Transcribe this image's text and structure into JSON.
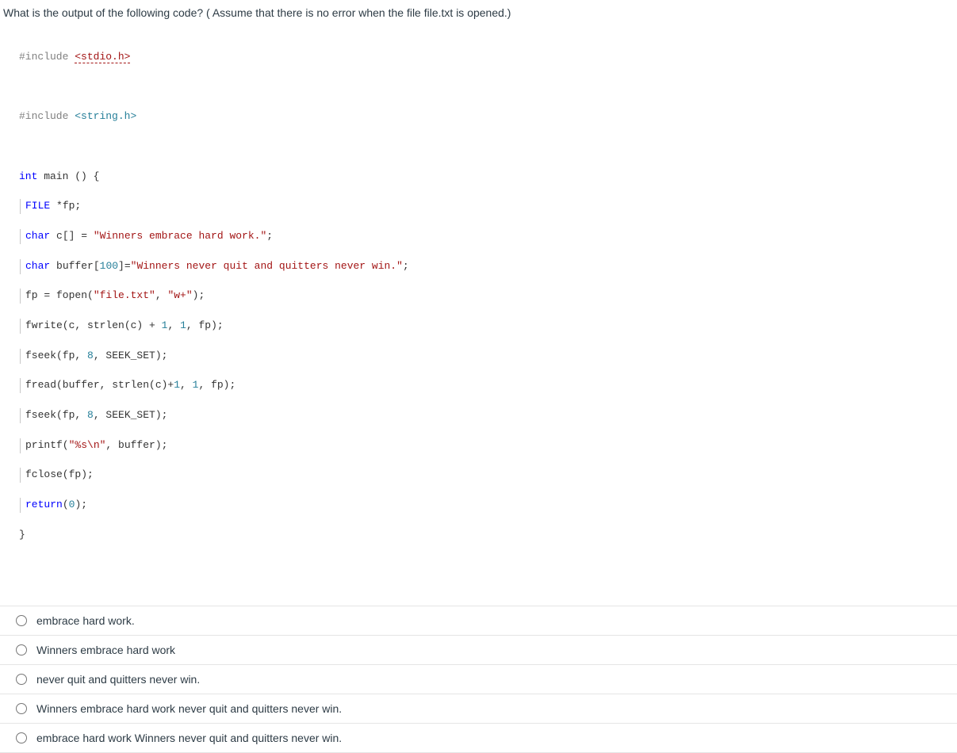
{
  "question": "What is the output of the following code? ( Assume that there is no error when the file file.txt is opened.)",
  "code": {
    "l1_inc": "#include",
    "l1_hdr": "<stdio.h>",
    "l2_inc": "#include",
    "l2_hdr": "<string.h>",
    "l3_type": "int",
    "l3_rest": " main () {",
    "l4a": "FILE",
    "l4b": " *fp;",
    "l5a": "char",
    "l5b": " c[] = ",
    "l5c": "\"Winners embrace hard work.\"",
    "l5d": ";",
    "l6a": "char",
    "l6b": " buffer[",
    "l6c": "100",
    "l6d": "]=",
    "l6e": "\"Winners never quit and quitters never win.\"",
    "l6f": ";",
    "l7a": "fp = fopen(",
    "l7b": "\"file.txt\"",
    "l7c": ", ",
    "l7d": "\"w+\"",
    "l7e": ");",
    "l8a": "fwrite(c, strlen(c) + ",
    "l8b": "1",
    "l8c": ", ",
    "l8d": "1",
    "l8e": ", fp);",
    "l9a": "fseek(fp, ",
    "l9b": "8",
    "l9c": ", SEEK_SET);",
    "l10a": "fread(buffer, strlen(c)+",
    "l10b": "1",
    "l10c": ", ",
    "l10d": "1",
    "l10e": ", fp);",
    "l11a": "fseek(fp, ",
    "l11b": "8",
    "l11c": ", SEEK_SET);",
    "l12a": "printf(",
    "l12b": "\"%s\\n\"",
    "l12c": ", buffer);",
    "l13": "fclose(fp);",
    "l14a": "return",
    "l14b": "(",
    "l14c": "0",
    "l14d": ");",
    "l15": "}"
  },
  "answers": [
    "embrace hard work.",
    "Winners embrace hard work",
    "never quit and quitters never win.",
    "Winners embrace hard work never quit and quitters never win.",
    "embrace hard work Winners never quit and quitters never win."
  ]
}
